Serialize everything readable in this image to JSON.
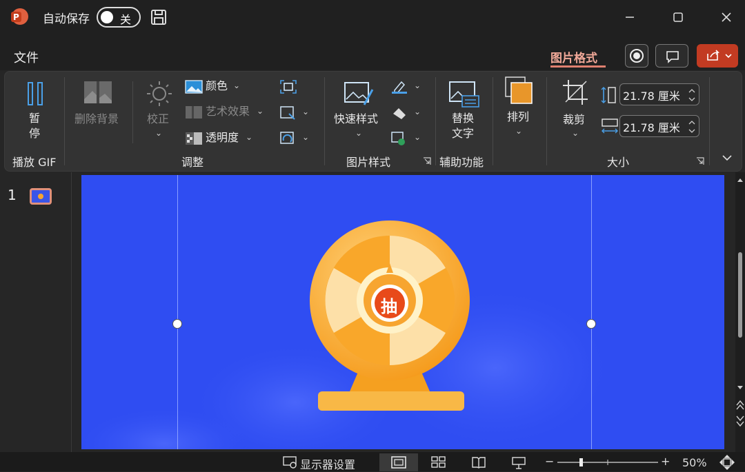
{
  "titlebar": {
    "autosave_label": "自动保存",
    "toggle_state": "关"
  },
  "menubar": {
    "file_tab": "文件",
    "picture_format_tab": "图片格式"
  },
  "ribbon": {
    "pause_label_1": "暂",
    "pause_label_2": "停",
    "play_gif_group": "播放 GIF",
    "remove_bg": "删除背景",
    "correct": "校正",
    "color": "颜色",
    "artistic": "艺术效果",
    "transparency": "透明度",
    "adjust_group": "调整",
    "quick_styles": "快速样式",
    "picture_styles_group": "图片样式",
    "alt_text_1": "替换",
    "alt_text_2": "文字",
    "accessibility_group": "辅助功能",
    "arrange": "排列",
    "crop": "裁剪",
    "height_value": "21.78 厘米",
    "width_value": "21.78 厘米",
    "size_group": "大小"
  },
  "slides": {
    "number": "1"
  },
  "slide_content": {
    "wheel_char": "抽"
  },
  "statusbar": {
    "display_settings": "显示器设置",
    "zoom": "50%"
  },
  "colors": {
    "accent": "#c23b22",
    "slide_bg": "#2f4df2",
    "wheel": "#f7a530"
  }
}
